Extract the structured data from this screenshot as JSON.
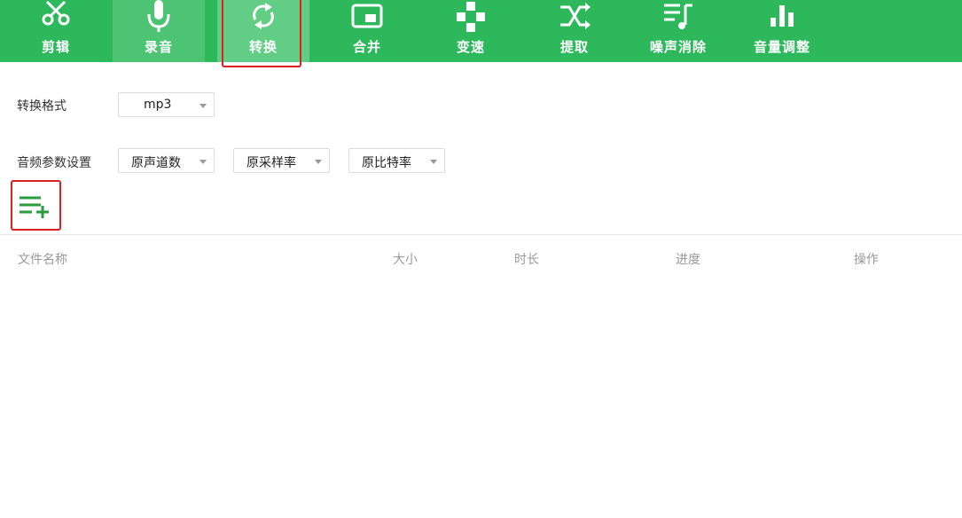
{
  "toolbar": {
    "items": [
      {
        "label": "剪辑",
        "icon": "scissors-icon"
      },
      {
        "label": "录音",
        "icon": "microphone-icon"
      },
      {
        "label": "转换",
        "icon": "convert-icon"
      },
      {
        "label": "合并",
        "icon": "merge-icon"
      },
      {
        "label": "变速",
        "icon": "speed-icon"
      },
      {
        "label": "提取",
        "icon": "extract-shuffle-icon"
      },
      {
        "label": "噪声消除",
        "icon": "noise-removal-icon"
      },
      {
        "label": "音量调整",
        "icon": "volume-bars-icon"
      }
    ],
    "active": "转换",
    "colors": {
      "bar": "#2db85c",
      "active": "#62cd85",
      "highlight": "#e02020"
    }
  },
  "format": {
    "label": "转换格式",
    "value": "mp3"
  },
  "audio_params": {
    "label": "音频参数设置",
    "channels": "原声道数",
    "sample_rate": "原采样率",
    "bitrate": "原比特率"
  },
  "add_file": {
    "icon": "add-list-icon"
  },
  "table": {
    "columns": [
      "文件名称",
      "大小",
      "时长",
      "进度",
      "操作"
    ]
  }
}
